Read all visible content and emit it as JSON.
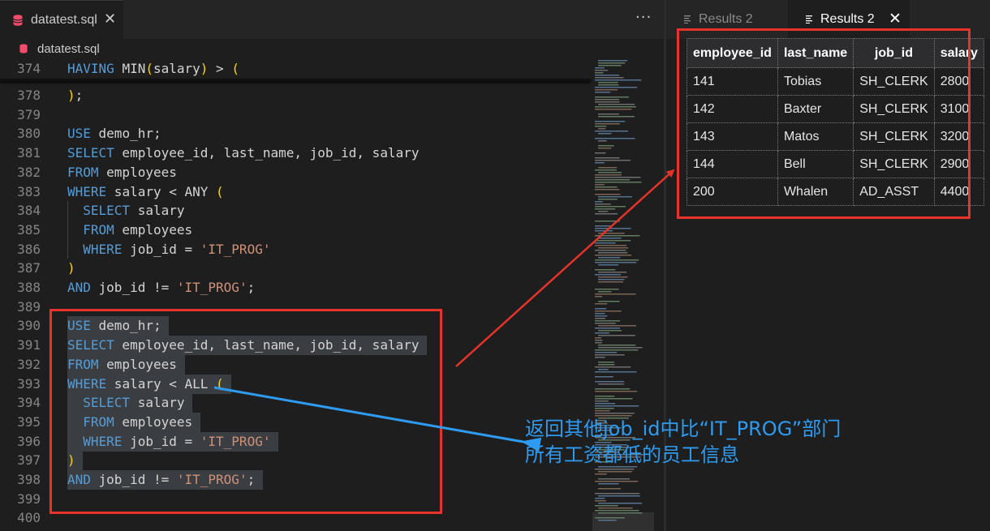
{
  "editor": {
    "tab_title": "datatest.sql",
    "tab_close": "✕",
    "more_actions": "···",
    "breadcrumb": "datatest.sql",
    "sticky_line": {
      "num": "374",
      "tokens": [
        [
          "kw",
          "HAVING "
        ],
        [
          "",
          "MIN"
        ],
        [
          "par",
          "("
        ],
        [
          "",
          "salary"
        ],
        [
          "par",
          ")"
        ],
        [
          "",
          " > "
        ],
        [
          "par",
          "("
        ]
      ]
    },
    "lines": [
      {
        "num": "378",
        "tokens": [
          [
            "par",
            ")"
          ],
          [
            "",
            ";"
          ]
        ]
      },
      {
        "num": "379",
        "tokens": []
      },
      {
        "num": "380",
        "tokens": [
          [
            "kw",
            "USE"
          ],
          [
            "",
            " demo_hr;"
          ]
        ]
      },
      {
        "num": "381",
        "tokens": [
          [
            "kw",
            "SELECT"
          ],
          [
            "",
            " employee_id, last_name, job_id, salary"
          ]
        ]
      },
      {
        "num": "382",
        "tokens": [
          [
            "kw",
            "FROM"
          ],
          [
            "",
            " employees"
          ]
        ]
      },
      {
        "num": "383",
        "tokens": [
          [
            "kw",
            "WHERE"
          ],
          [
            "",
            " salary < ANY "
          ],
          [
            "par",
            "("
          ]
        ]
      },
      {
        "num": "384",
        "tokens": [
          [
            "",
            "  "
          ],
          [
            "kw",
            "SELECT"
          ],
          [
            "",
            " salary"
          ]
        ]
      },
      {
        "num": "385",
        "tokens": [
          [
            "",
            "  "
          ],
          [
            "kw",
            "FROM"
          ],
          [
            "",
            " employees"
          ]
        ]
      },
      {
        "num": "386",
        "tokens": [
          [
            "",
            "  "
          ],
          [
            "kw",
            "WHERE"
          ],
          [
            "",
            " job_id = "
          ],
          [
            "str",
            "'IT_PROG'"
          ]
        ]
      },
      {
        "num": "387",
        "tokens": [
          [
            "par",
            ")"
          ]
        ]
      },
      {
        "num": "388",
        "tokens": [
          [
            "kw",
            "AND"
          ],
          [
            "",
            " job_id != "
          ],
          [
            "str",
            "'IT_PROG'"
          ],
          [
            "",
            ";"
          ]
        ]
      },
      {
        "num": "389",
        "tokens": []
      },
      {
        "num": "390",
        "tokens": [
          [
            "kw",
            "USE"
          ],
          [
            "",
            " demo_hr;"
          ]
        ]
      },
      {
        "num": "391",
        "tokens": [
          [
            "kw",
            "SELECT"
          ],
          [
            "",
            " employee_id, last_name, job_id, salary"
          ]
        ]
      },
      {
        "num": "392",
        "tokens": [
          [
            "kw",
            "FROM"
          ],
          [
            "",
            " employees"
          ]
        ]
      },
      {
        "num": "393",
        "tokens": [
          [
            "kw",
            "WHERE"
          ],
          [
            "",
            " salary < ALL "
          ],
          [
            "par",
            "("
          ]
        ]
      },
      {
        "num": "394",
        "tokens": [
          [
            "",
            "  "
          ],
          [
            "kw",
            "SELECT"
          ],
          [
            "",
            " salary"
          ]
        ]
      },
      {
        "num": "395",
        "tokens": [
          [
            "",
            "  "
          ],
          [
            "kw",
            "FROM"
          ],
          [
            "",
            " employees"
          ]
        ]
      },
      {
        "num": "396",
        "tokens": [
          [
            "",
            "  "
          ],
          [
            "kw",
            "WHERE"
          ],
          [
            "",
            " job_id = "
          ],
          [
            "str",
            "'IT_PROG'"
          ]
        ]
      },
      {
        "num": "397",
        "tokens": [
          [
            "par",
            ")"
          ]
        ]
      },
      {
        "num": "398",
        "tokens": [
          [
            "kw",
            "AND"
          ],
          [
            "",
            " job_id != "
          ],
          [
            "str",
            "'IT_PROG'"
          ],
          [
            "",
            ";"
          ]
        ]
      },
      {
        "num": "399",
        "tokens": []
      },
      {
        "num": "400",
        "tokens": []
      }
    ]
  },
  "results": {
    "tabs": [
      {
        "label": "Results 2",
        "active": false
      },
      {
        "label": "Results 2",
        "active": true
      }
    ],
    "close_glyph": "✕",
    "columns": [
      "employee_id",
      "last_name",
      "job_id",
      "salary"
    ],
    "rows": [
      [
        "141",
        "Tobias",
        "SH_CLERK",
        "2800"
      ],
      [
        "142",
        "Baxter",
        "SH_CLERK",
        "3100"
      ],
      [
        "143",
        "Matos",
        "SH_CLERK",
        "3200"
      ],
      [
        "144",
        "Bell",
        "SH_CLERK",
        "2900"
      ],
      [
        "200",
        "Whalen",
        "AD_ASST",
        "4400"
      ]
    ]
  },
  "annotation": {
    "line1": "返回其他job_id中比“IT_PROG”部门",
    "line2": "所有工资都低的员工信息"
  },
  "colors": {
    "annotation_red": "#e8332a",
    "annotation_blue": "#2f9bf0",
    "keyword": "#569cd6",
    "string": "#ce9178",
    "bracket": "#ffd700",
    "db_icon": "#f14c6b"
  },
  "icons": {
    "file_icon": "database-icon",
    "results_tab_icon": "list-icon"
  }
}
